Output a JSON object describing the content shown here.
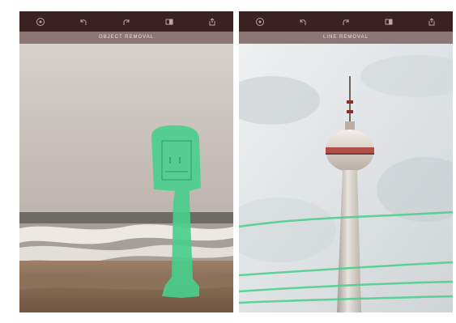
{
  "icons": [
    "brush-icon",
    "undo-icon",
    "redo-icon",
    "compare-icon",
    "share-icon"
  ],
  "panels": [
    {
      "mode_label": "OBJECT REMOVAL"
    },
    {
      "mode_label": "LINE REMOVAL"
    }
  ],
  "colors": {
    "toolbar": "#3b2120",
    "modebar": "#8d7676",
    "icon": "#b9a9a7",
    "selection": "#47cf8c"
  }
}
